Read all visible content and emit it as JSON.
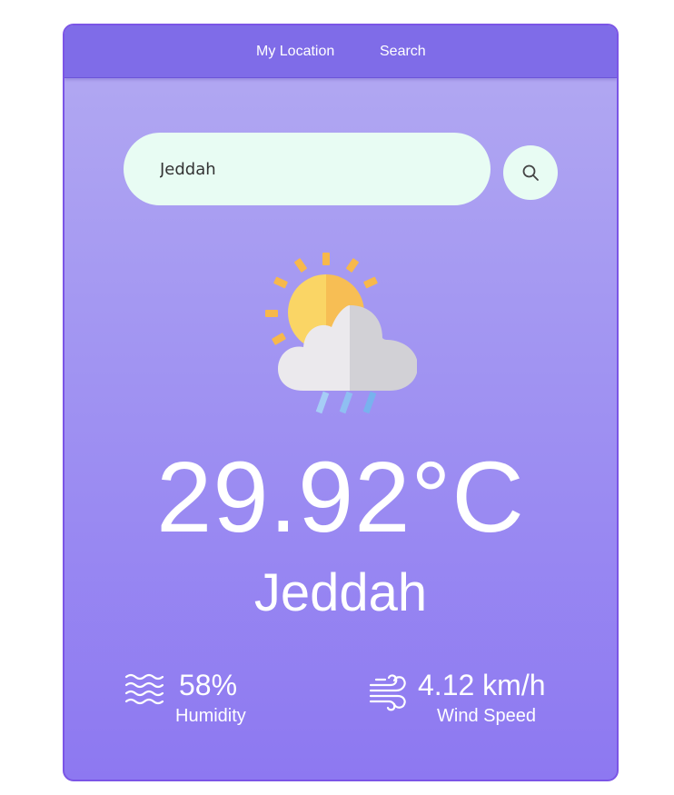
{
  "nav": {
    "my_location_label": "My Location",
    "search_label": "Search"
  },
  "search": {
    "value": "Jeddah",
    "button_icon": "search-icon"
  },
  "weather": {
    "icon": "sun-cloud-rain-icon",
    "temperature": "29.92°C",
    "city": "Jeddah"
  },
  "stats": {
    "humidity": {
      "icon": "waves-icon",
      "value": "58%",
      "label": "Humidity"
    },
    "wind": {
      "icon": "wind-icon",
      "value": "4.12 km/h",
      "label": "Wind Speed"
    }
  },
  "colors": {
    "card_border": "#7b55e6",
    "navbar": "#7f6ce8",
    "gradient_top": "#b3aaf2",
    "gradient_bottom": "#8d78f1",
    "input_bg": "#e8fcf3",
    "text": "#ffffff"
  }
}
